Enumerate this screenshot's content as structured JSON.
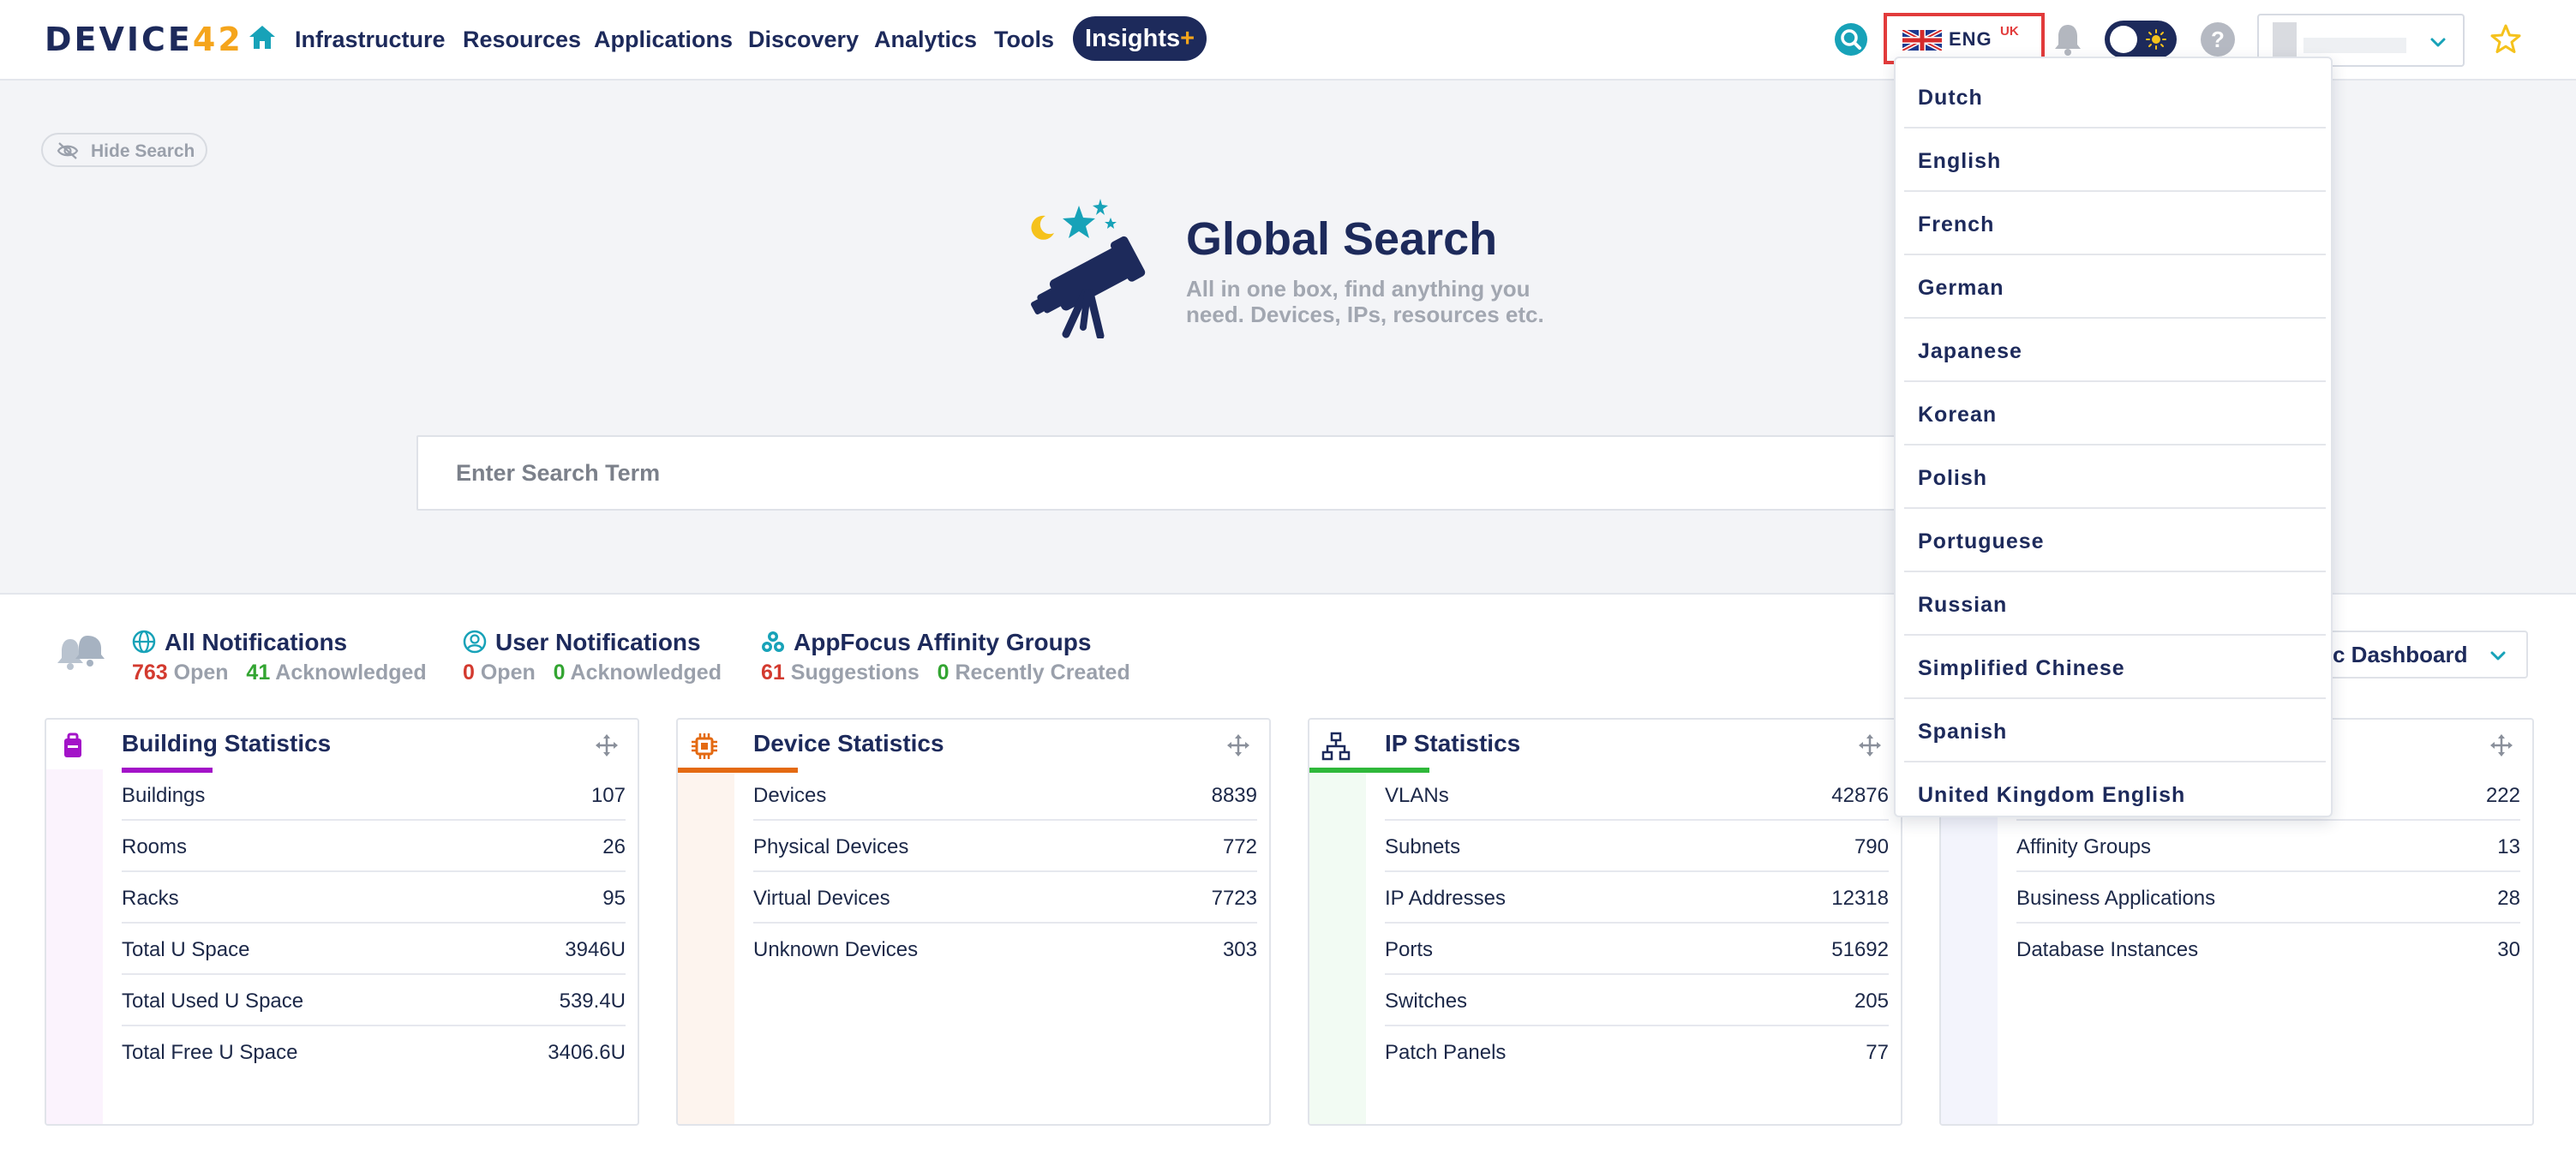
{
  "brand": {
    "logo_main": "DEVICE",
    "logo_accent": "42"
  },
  "nav": {
    "items": [
      "Infrastructure",
      "Resources",
      "Applications",
      "Discovery",
      "Analytics",
      "Tools"
    ],
    "insights_label": "Insights",
    "insights_plus": "+"
  },
  "language": {
    "code": "ENG",
    "region": "UK",
    "options": [
      "Dutch",
      "English",
      "French",
      "German",
      "Japanese",
      "Korean",
      "Polish",
      "Portuguese",
      "Russian",
      "Simplified Chinese",
      "Spanish",
      "United Kingdom English"
    ]
  },
  "theme": {
    "mode": "light"
  },
  "help_label": "?",
  "search": {
    "hide_label": "Hide Search",
    "title": "Global Search",
    "subtitle": "All in one box, find anything you need. Devices, IPs, resources etc.",
    "placeholder": "Enter Search Term"
  },
  "notifications": {
    "all": {
      "title": "All Notifications",
      "open_count": "763",
      "open_label": "Open",
      "ack_count": "41",
      "ack_label": "Acknowledged"
    },
    "user": {
      "title": "User Notifications",
      "open_count": "0",
      "open_label": "Open",
      "ack_count": "0",
      "ack_label": "Acknowledged"
    },
    "affinity": {
      "title": "AppFocus Affinity Groups",
      "sugg_count": "61",
      "sugg_label": "Suggestions",
      "recent_count": "0",
      "recent_label": "Recently Created"
    }
  },
  "dashboard_select": {
    "value": "c Dashboard"
  },
  "cards": [
    {
      "title": "Building Statistics",
      "accent": "#a313c8",
      "rows": [
        {
          "label": "Buildings",
          "value": "107"
        },
        {
          "label": "Rooms",
          "value": "26"
        },
        {
          "label": "Racks",
          "value": "95"
        },
        {
          "label": "Total U Space",
          "value": "3946U"
        },
        {
          "label": "Total Used U Space",
          "value": "539.4U"
        },
        {
          "label": "Total Free U Space",
          "value": "3406.6U"
        }
      ]
    },
    {
      "title": "Device Statistics",
      "accent": "#e46a12",
      "rows": [
        {
          "label": "Devices",
          "value": "8839"
        },
        {
          "label": "Physical Devices",
          "value": "772"
        },
        {
          "label": "Virtual Devices",
          "value": "7723"
        },
        {
          "label": "Unknown Devices",
          "value": "303"
        }
      ]
    },
    {
      "title": "IP Statistics",
      "accent": "#2fb83a",
      "rows": [
        {
          "label": "VLANs",
          "value": "42876"
        },
        {
          "label": "Subnets",
          "value": "790"
        },
        {
          "label": "IP Addresses",
          "value": "12318"
        },
        {
          "label": "Ports",
          "value": "51692"
        },
        {
          "label": "Switches",
          "value": "205"
        },
        {
          "label": "Patch Panels",
          "value": "77"
        }
      ]
    },
    {
      "title": "",
      "accent": "#4a5bd1",
      "rows": [
        {
          "label": "",
          "value": "222"
        },
        {
          "label": "Affinity Groups",
          "value": "13"
        },
        {
          "label": "Business Applications",
          "value": "28"
        },
        {
          "label": "Database Instances",
          "value": "30"
        }
      ]
    }
  ],
  "colors": {
    "navy": "#1d2a5b",
    "accent_orange": "#f5a51c",
    "teal": "#17a2b8",
    "highlight_red": "#e23b3b",
    "count_red": "#d33a2f",
    "count_green": "#33a532"
  }
}
